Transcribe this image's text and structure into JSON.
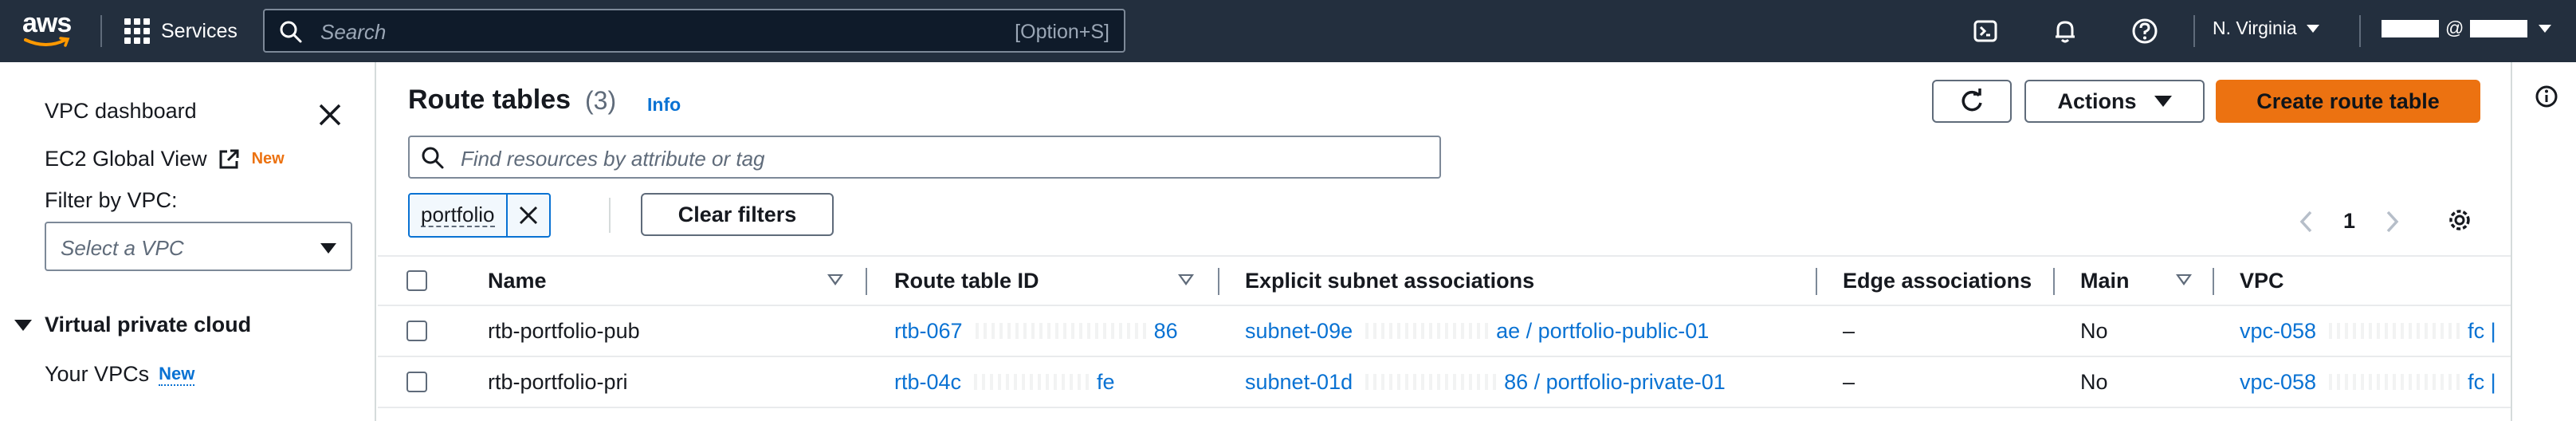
{
  "topbar": {
    "logo_text": "aws",
    "services_label": "Services",
    "search_placeholder": "Search",
    "search_shortcut": "[Option+S]",
    "region_label": "N. Virginia",
    "account_at": "@",
    "icons": [
      "cloudshell-icon",
      "bell-icon",
      "help-icon",
      "settings-icon"
    ]
  },
  "sidenav": {
    "vpc_dashboard": "VPC dashboard",
    "ec2_global_view": "EC2 Global View",
    "ec2_new_badge": "New",
    "filter_label": "Filter by VPC:",
    "vpc_select_placeholder": "Select a VPC",
    "section_title": "Virtual private cloud",
    "your_vpcs": "Your VPCs",
    "your_vpcs_badge": "New"
  },
  "main": {
    "title": "Route tables",
    "count": "(3)",
    "info": "Info",
    "actions_label": "Actions",
    "create_label": "Create route table",
    "find_placeholder": "Find resources by attribute or tag",
    "filter_token": "portfolio",
    "clear_filters": "Clear filters",
    "page_number": "1"
  },
  "table": {
    "columns": [
      "Name",
      "Route table ID",
      "Explicit subnet associations",
      "Edge associations",
      "Main",
      "VPC"
    ],
    "rows": [
      {
        "name": "rtb-portfolio-pub",
        "id_prefix": "rtb-067",
        "id_suffix": "86",
        "subnet_prefix": "subnet-09e",
        "subnet_suffix": "ae / portfolio-public-01",
        "edge": "–",
        "main": "No",
        "vpc": "vpc-058",
        "vpc_tail": "fc |"
      },
      {
        "name": "rtb-portfolio-pri",
        "id_prefix": "rtb-04c",
        "id_suffix": "fe",
        "subnet_prefix": "subnet-01d",
        "subnet_suffix": "86 / portfolio-private-01",
        "edge": "–",
        "main": "No",
        "vpc": "vpc-058",
        "vpc_tail": "fc |"
      }
    ]
  },
  "colors": {
    "topbar_bg": "#232f3e",
    "primary_orange": "#ec7211",
    "link_blue": "#0972d3"
  }
}
